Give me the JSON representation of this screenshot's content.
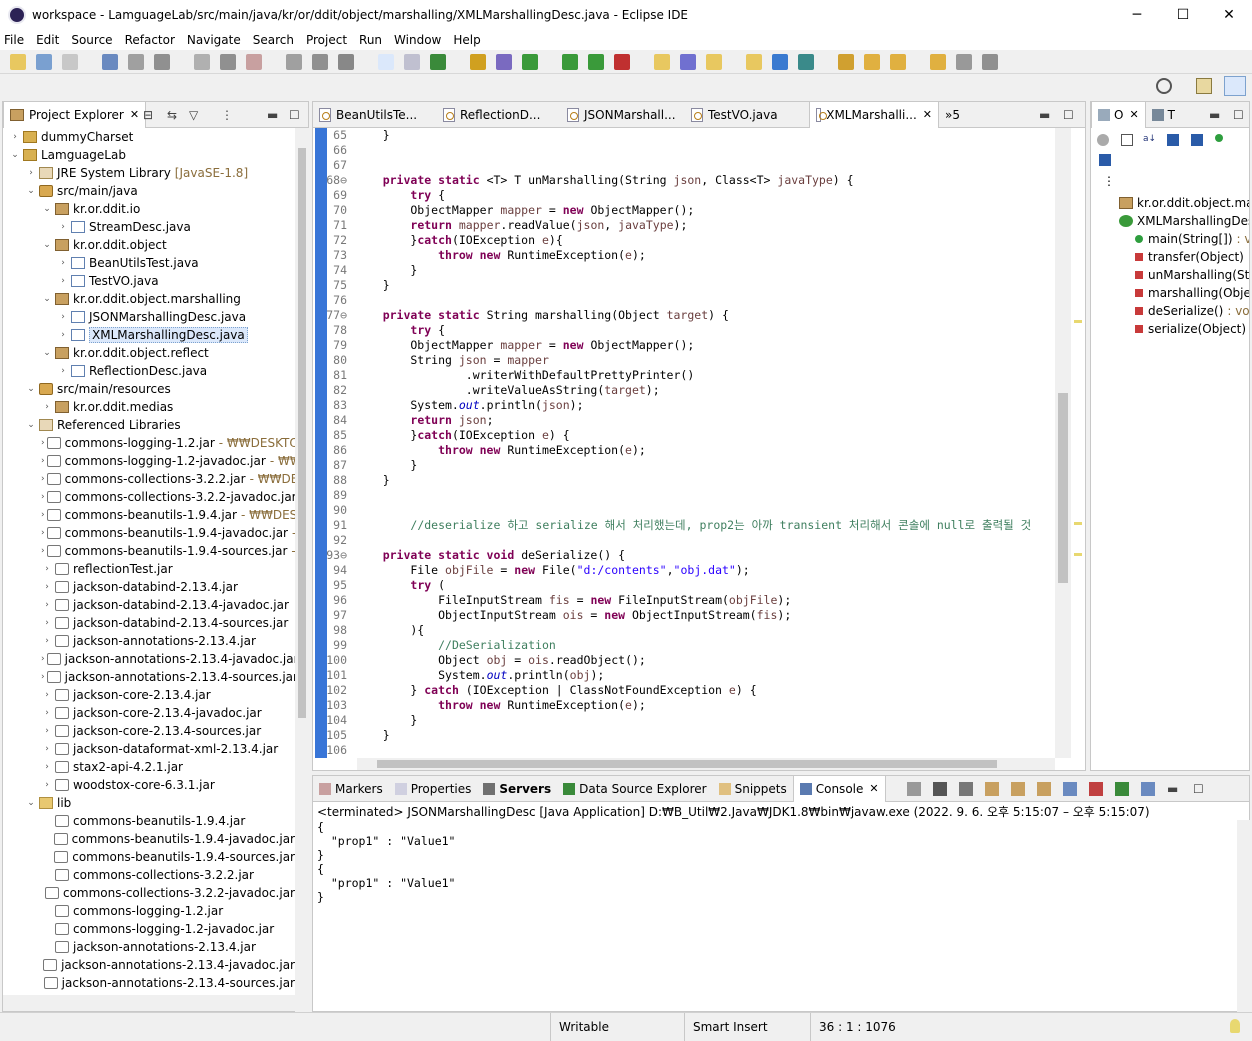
{
  "window": {
    "title": "workspace - LamguageLab/src/main/java/kr/or/ddit/object/marshalling/XMLMarshallingDesc.java - Eclipse IDE",
    "minimize": "─",
    "maximize": "☐",
    "close": "✕"
  },
  "menu": [
    "File",
    "Edit",
    "Source",
    "Refactor",
    "Navigate",
    "Search",
    "Project",
    "Run",
    "Window",
    "Help"
  ],
  "explorer": {
    "title": "Project Explorer",
    "items": [
      {
        "label": "dummyCharset",
        "path": "",
        "indent": 0,
        "arrow": "›",
        "icon": "proj"
      },
      {
        "label": "LamguageLab",
        "path": "",
        "indent": 0,
        "arrow": "⌄",
        "icon": "proj"
      },
      {
        "label": "JRE System Library",
        "path": "[JavaSE-1.8]",
        "indent": 1,
        "arrow": "›",
        "icon": "lib"
      },
      {
        "label": "src/main/java",
        "path": "",
        "indent": 1,
        "arrow": "⌄",
        "icon": "src"
      },
      {
        "label": "kr.or.ddit.io",
        "path": "",
        "indent": 2,
        "arrow": "⌄",
        "icon": "pkg"
      },
      {
        "label": "StreamDesc.java",
        "path": "",
        "indent": 3,
        "arrow": "›",
        "icon": "java"
      },
      {
        "label": "kr.or.ddit.object",
        "path": "",
        "indent": 2,
        "arrow": "⌄",
        "icon": "pkg"
      },
      {
        "label": "BeanUtilsTest.java",
        "path": "",
        "indent": 3,
        "arrow": "›",
        "icon": "java"
      },
      {
        "label": "TestVO.java",
        "path": "",
        "indent": 3,
        "arrow": "›",
        "icon": "java"
      },
      {
        "label": "kr.or.ddit.object.marshalling",
        "path": "",
        "indent": 2,
        "arrow": "⌄",
        "icon": "pkg"
      },
      {
        "label": "JSONMarshallingDesc.java",
        "path": "",
        "indent": 3,
        "arrow": "›",
        "icon": "java"
      },
      {
        "label": "XMLMarshallingDesc.java",
        "path": "",
        "indent": 3,
        "arrow": "›",
        "icon": "java",
        "selected": true
      },
      {
        "label": "kr.or.ddit.object.reflect",
        "path": "",
        "indent": 2,
        "arrow": "⌄",
        "icon": "pkg"
      },
      {
        "label": "ReflectionDesc.java",
        "path": "",
        "indent": 3,
        "arrow": "›",
        "icon": "java"
      },
      {
        "label": "src/main/resources",
        "path": "",
        "indent": 1,
        "arrow": "⌄",
        "icon": "src"
      },
      {
        "label": "kr.or.ddit.medias",
        "path": "",
        "indent": 2,
        "arrow": "›",
        "icon": "pkg"
      },
      {
        "label": "Referenced Libraries",
        "path": "",
        "indent": 1,
        "arrow": "⌄",
        "icon": "lib"
      },
      {
        "label": "commons-logging-1.2.jar",
        "path": "- ₩₩DESKTOP",
        "indent": 2,
        "arrow": "›",
        "icon": "jar"
      },
      {
        "label": "commons-logging-1.2-javadoc.jar",
        "path": "- ₩₩D",
        "indent": 2,
        "arrow": "›",
        "icon": "jar"
      },
      {
        "label": "commons-collections-3.2.2.jar",
        "path": "- ₩₩DES",
        "indent": 2,
        "arrow": "›",
        "icon": "jar"
      },
      {
        "label": "commons-collections-3.2.2-javadoc.jar",
        "path": "-",
        "indent": 2,
        "arrow": "›",
        "icon": "jar"
      },
      {
        "label": "commons-beanutils-1.9.4.jar",
        "path": "- ₩₩DESKT",
        "indent": 2,
        "arrow": "›",
        "icon": "jar"
      },
      {
        "label": "commons-beanutils-1.9.4-javadoc.jar",
        "path": "- ₩",
        "indent": 2,
        "arrow": "›",
        "icon": "jar"
      },
      {
        "label": "commons-beanutils-1.9.4-sources.jar",
        "path": "- ₩",
        "indent": 2,
        "arrow": "›",
        "icon": "jar"
      },
      {
        "label": "reflectionTest.jar",
        "path": "",
        "indent": 2,
        "arrow": "›",
        "icon": "jar"
      },
      {
        "label": "jackson-databind-2.13.4.jar",
        "path": "",
        "indent": 2,
        "arrow": "›",
        "icon": "jar"
      },
      {
        "label": "jackson-databind-2.13.4-javadoc.jar",
        "path": "",
        "indent": 2,
        "arrow": "›",
        "icon": "jar"
      },
      {
        "label": "jackson-databind-2.13.4-sources.jar",
        "path": "",
        "indent": 2,
        "arrow": "›",
        "icon": "jar"
      },
      {
        "label": "jackson-annotations-2.13.4.jar",
        "path": "",
        "indent": 2,
        "arrow": "›",
        "icon": "jar"
      },
      {
        "label": "jackson-annotations-2.13.4-javadoc.jar",
        "path": "",
        "indent": 2,
        "arrow": "›",
        "icon": "jar"
      },
      {
        "label": "jackson-annotations-2.13.4-sources.jar",
        "path": "",
        "indent": 2,
        "arrow": "›",
        "icon": "jar"
      },
      {
        "label": "jackson-core-2.13.4.jar",
        "path": "",
        "indent": 2,
        "arrow": "›",
        "icon": "jar"
      },
      {
        "label": "jackson-core-2.13.4-javadoc.jar",
        "path": "",
        "indent": 2,
        "arrow": "›",
        "icon": "jar"
      },
      {
        "label": "jackson-core-2.13.4-sources.jar",
        "path": "",
        "indent": 2,
        "arrow": "›",
        "icon": "jar"
      },
      {
        "label": "jackson-dataformat-xml-2.13.4.jar",
        "path": "",
        "indent": 2,
        "arrow": "›",
        "icon": "jar"
      },
      {
        "label": "stax2-api-4.2.1.jar",
        "path": "",
        "indent": 2,
        "arrow": "›",
        "icon": "jar"
      },
      {
        "label": "woodstox-core-6.3.1.jar",
        "path": "",
        "indent": 2,
        "arrow": "›",
        "icon": "jar"
      },
      {
        "label": "lib",
        "path": "",
        "indent": 1,
        "arrow": "⌄",
        "icon": "folder"
      },
      {
        "label": "commons-beanutils-1.9.4.jar",
        "path": "",
        "indent": 2,
        "arrow": "",
        "icon": "jar"
      },
      {
        "label": "commons-beanutils-1.9.4-javadoc.jar",
        "path": "",
        "indent": 2,
        "arrow": "",
        "icon": "jar"
      },
      {
        "label": "commons-beanutils-1.9.4-sources.jar",
        "path": "",
        "indent": 2,
        "arrow": "",
        "icon": "jar"
      },
      {
        "label": "commons-collections-3.2.2.jar",
        "path": "",
        "indent": 2,
        "arrow": "",
        "icon": "jar"
      },
      {
        "label": "commons-collections-3.2.2-javadoc.jar",
        "path": "",
        "indent": 2,
        "arrow": "",
        "icon": "jar"
      },
      {
        "label": "commons-logging-1.2.jar",
        "path": "",
        "indent": 2,
        "arrow": "",
        "icon": "jar"
      },
      {
        "label": "commons-logging-1.2-javadoc.jar",
        "path": "",
        "indent": 2,
        "arrow": "",
        "icon": "jar"
      },
      {
        "label": "jackson-annotations-2.13.4.jar",
        "path": "",
        "indent": 2,
        "arrow": "",
        "icon": "jar"
      },
      {
        "label": "jackson-annotations-2.13.4-javadoc.jar",
        "path": "",
        "indent": 2,
        "arrow": "",
        "icon": "jar"
      },
      {
        "label": "jackson-annotations-2.13.4-sources.jar",
        "path": "",
        "indent": 2,
        "arrow": "",
        "icon": "jar"
      }
    ]
  },
  "editor": {
    "tabs": [
      {
        "label": "BeanUtilsTe...",
        "active": false
      },
      {
        "label": "ReflectionD...",
        "active": false
      },
      {
        "label": "JSONMarshall...",
        "active": false
      },
      {
        "label": "TestVO.java",
        "active": false
      },
      {
        "label": "XMLMarshalli...",
        "active": true
      }
    ],
    "overflow": "»5",
    "lines": [
      {
        "n": "65",
        "html": "    }"
      },
      {
        "n": "66",
        "html": ""
      },
      {
        "n": "67",
        "html": ""
      },
      {
        "n": "68⊖",
        "html": "    <span class='kw'>private static</span> &lt;T&gt; T unMarshalling(String <span class='vr'>json</span>, Class&lt;T&gt; <span class='vr'>javaType</span>) {"
      },
      {
        "n": "69",
        "html": "        <span class='kw'>try</span> {"
      },
      {
        "n": "70",
        "html": "        ObjectMapper <span class='vr'>mapper</span> = <span class='kw'>new</span> ObjectMapper();"
      },
      {
        "n": "71",
        "html": "        <span class='kw'>return</span> <span class='vr'>mapper</span>.readValue(<span class='vr'>json</span>, <span class='vr'>javaType</span>);"
      },
      {
        "n": "72",
        "html": "        }<span class='kw'>catch</span>(IOException <span class='vr'>e</span>){"
      },
      {
        "n": "73",
        "html": "            <span class='kw'>throw new</span> RuntimeException(<span class='vr'>e</span>);"
      },
      {
        "n": "74",
        "html": "        }"
      },
      {
        "n": "75",
        "html": "    }"
      },
      {
        "n": "76",
        "html": ""
      },
      {
        "n": "77⊖",
        "html": "    <span class='kw'>private static</span> String marshalling(Object <span class='vr'>target</span>) {"
      },
      {
        "n": "78",
        "html": "        <span class='kw'>try</span> {"
      },
      {
        "n": "79",
        "html": "        ObjectMapper <span class='vr'>mapper</span> = <span class='kw'>new</span> ObjectMapper();"
      },
      {
        "n": "80",
        "html": "        String <span class='vr'>json</span> = <span class='vr'>mapper</span>"
      },
      {
        "n": "81",
        "html": "                .writerWithDefaultPrettyPrinter()"
      },
      {
        "n": "82",
        "html": "                .writeValueAsString(<span class='vr'>target</span>);"
      },
      {
        "n": "83",
        "html": "        System.<span class='fld'>out</span>.println(<span class='vr'>json</span>);"
      },
      {
        "n": "84",
        "html": "        <span class='kw'>return</span> <span class='vr'>json</span>;"
      },
      {
        "n": "85",
        "html": "        }<span class='kw'>catch</span>(IOException <span class='vr'>e</span>) {"
      },
      {
        "n": "86",
        "html": "            <span class='kw'>throw new</span> RuntimeException(<span class='vr'>e</span>);"
      },
      {
        "n": "87",
        "html": "        }"
      },
      {
        "n": "88",
        "html": "    }"
      },
      {
        "n": "89",
        "html": ""
      },
      {
        "n": "90",
        "html": ""
      },
      {
        "n": "91",
        "html": "        <span class='cm'>//deserialize 하고 serialize 해서 처리했는데, prop2는 아까 transient 처리해서 콘솔에 null로 출력될 것</span>"
      },
      {
        "n": "92",
        "html": ""
      },
      {
        "n": "93⊖",
        "html": "    <span class='kw'>private static void</span> deSerialize() {"
      },
      {
        "n": "94",
        "html": "        File <span class='vr'>objFile</span> = <span class='kw'>new</span> File(<span class='st'>\"d:/contents\"</span>,<span class='st'>\"obj.dat\"</span>);"
      },
      {
        "n": "95",
        "html": "        <span class='kw'>try</span> ("
      },
      {
        "n": "96",
        "html": "            FileInputStream <span class='vr'>fis</span> = <span class='kw'>new</span> FileInputStream(<span class='vr'>objFile</span>);"
      },
      {
        "n": "97",
        "html": "            ObjectInputStream <span class='vr'>ois</span> = <span class='kw'>new</span> ObjectInputStream(<span class='vr'>fis</span>);"
      },
      {
        "n": "98",
        "html": "        ){"
      },
      {
        "n": "99",
        "html": "            <span class='cm'>//DeSerialization</span>"
      },
      {
        "n": "100",
        "html": "            Object <span class='vr'>obj</span> = <span class='vr'>ois</span>.readObject();"
      },
      {
        "n": "101",
        "html": "            System.<span class='fld'>out</span>.println(<span class='vr'>obj</span>);"
      },
      {
        "n": "102",
        "html": "        } <span class='kw'>catch</span> (IOException | ClassNotFoundException <span class='vr'>e</span>) {"
      },
      {
        "n": "103",
        "html": "            <span class='kw'>throw new</span> RuntimeException(<span class='vr'>e</span>);"
      },
      {
        "n": "104",
        "html": "        }"
      },
      {
        "n": "105",
        "html": "    }"
      },
      {
        "n": "106",
        "html": ""
      }
    ]
  },
  "outline": {
    "tabs": [
      "O",
      "T"
    ],
    "items": [
      {
        "label": "kr.or.ddit.object.mar",
        "ret": "",
        "indent": 0,
        "mark": "pkg"
      },
      {
        "label": "XMLMarshallingDesc",
        "ret": "",
        "indent": 0,
        "mark": "class"
      },
      {
        "label": "main(String[])",
        "ret": ": v",
        "indent": 1,
        "mark": "pub"
      },
      {
        "label": "transfer(Object)",
        "ret": ":",
        "indent": 1,
        "mark": "priv"
      },
      {
        "label": "unMarshalling(St",
        "ret": "",
        "indent": 1,
        "mark": "priv"
      },
      {
        "label": "marshalling(Obje",
        "ret": "",
        "indent": 1,
        "mark": "priv"
      },
      {
        "label": "deSerialize()",
        "ret": ": voi",
        "indent": 1,
        "mark": "priv"
      },
      {
        "label": "serialize(Object)",
        "ret": ":",
        "indent": 1,
        "mark": "priv"
      }
    ]
  },
  "console": {
    "tabs": [
      {
        "label": "Markers",
        "active": false
      },
      {
        "label": "Properties",
        "active": false
      },
      {
        "label": "Servers",
        "active": false,
        "bold": true
      },
      {
        "label": "Data Source Explorer",
        "active": false
      },
      {
        "label": "Snippets",
        "active": false
      },
      {
        "label": "Console",
        "active": true
      }
    ],
    "status": "<terminated> JSONMarshallingDesc [Java Application] D:₩B_Util₩2.Java₩JDK1.8₩bin₩javaw.exe  (2022. 9. 6. 오후 5:15:07 – 오후 5:15:07)",
    "output": "{\n  \"prop1\" : \"Value1\"\n}\n{\n  \"prop1\" : \"Value1\"\n}"
  },
  "statusbar": {
    "writable": "Writable",
    "insert": "Smart Insert",
    "position": "36 : 1 : 1076"
  }
}
